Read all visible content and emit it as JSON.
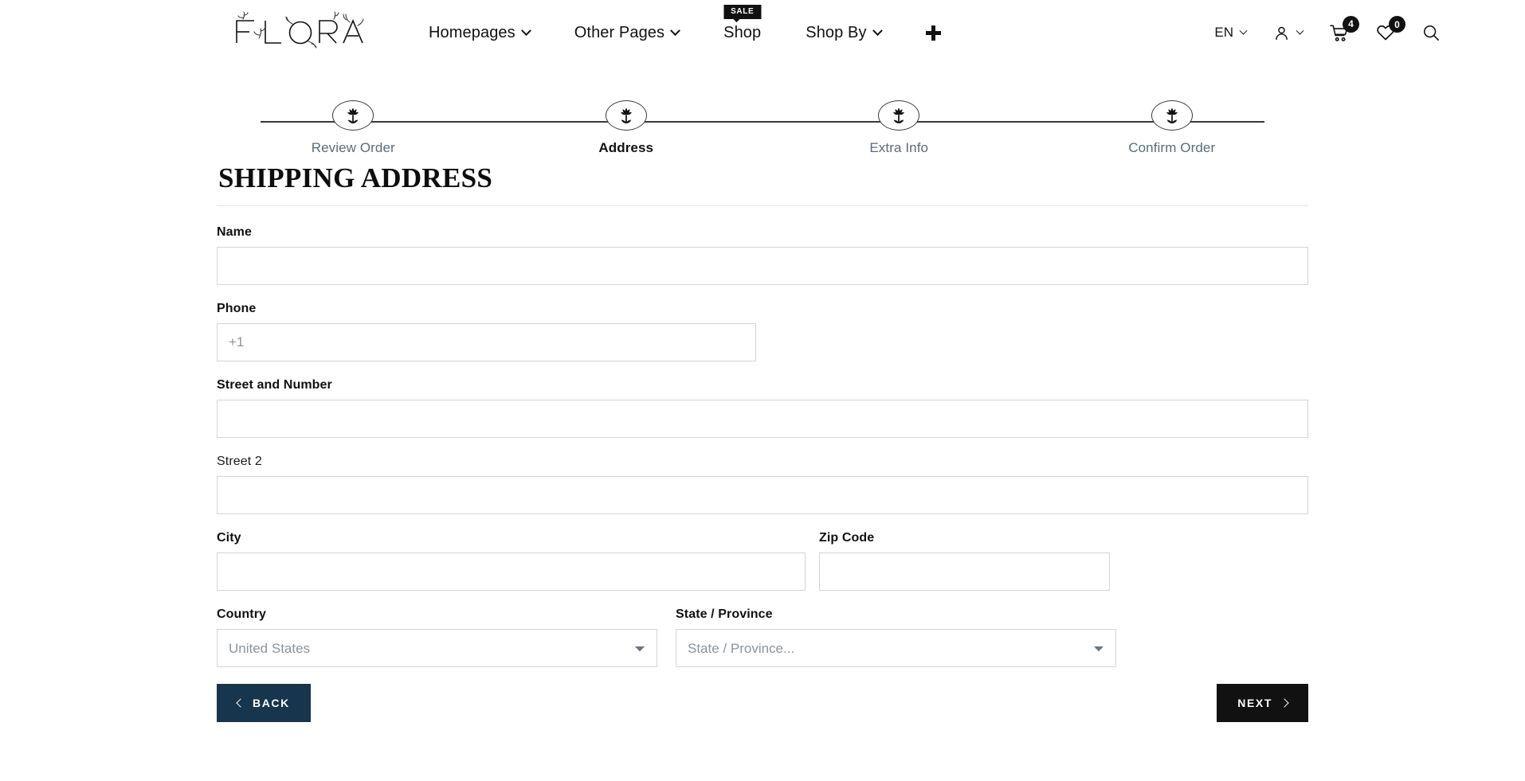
{
  "header": {
    "logo_text": "FLORA",
    "nav": [
      {
        "label": "Homepages",
        "has_caret": true,
        "badge": null
      },
      {
        "label": "Other Pages",
        "has_caret": true,
        "badge": null
      },
      {
        "label": "Shop",
        "has_caret": false,
        "badge": "SALE"
      },
      {
        "label": "Shop By",
        "has_caret": true,
        "badge": null
      }
    ],
    "add_icon": "plus-icon",
    "language": "EN",
    "account_icon": "user-icon",
    "cart_icon": "cart-icon",
    "cart_count": "4",
    "wishlist_icon": "heart-icon",
    "wishlist_count": "0",
    "search_icon": "search-icon"
  },
  "stepper": {
    "steps": [
      {
        "label": "Review Order",
        "active": false
      },
      {
        "label": "Address",
        "active": true
      },
      {
        "label": "Extra Info",
        "active": false
      },
      {
        "label": "Confirm Order",
        "active": false
      }
    ]
  },
  "form": {
    "title": "SHIPPING ADDRESS",
    "name": {
      "label": "Name",
      "value": "",
      "placeholder": ""
    },
    "phone": {
      "label": "Phone",
      "value": "",
      "placeholder": "+1"
    },
    "street": {
      "label": "Street and Number",
      "value": "",
      "placeholder": ""
    },
    "street2": {
      "label": "Street 2",
      "value": "",
      "placeholder": ""
    },
    "city": {
      "label": "City",
      "value": "",
      "placeholder": ""
    },
    "zip": {
      "label": "Zip Code",
      "value": "",
      "placeholder": ""
    },
    "country": {
      "label": "Country",
      "selected": "United States"
    },
    "state": {
      "label": "State / Province",
      "selected": "State / Province..."
    }
  },
  "actions": {
    "back_label": "BACK",
    "next_label": "NEXT"
  },
  "colors": {
    "back_button": "#17354c",
    "next_button": "#111111",
    "step_inactive_text": "#5a6b7a",
    "field_border": "#cfd6dd"
  }
}
